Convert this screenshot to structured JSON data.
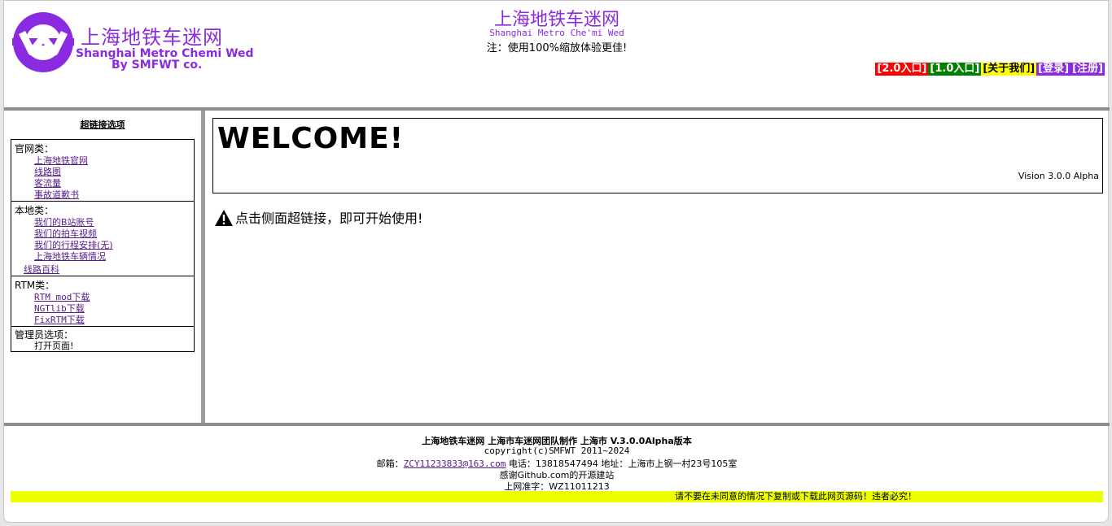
{
  "header": {
    "logo_cn": "上海地铁车迷网",
    "logo_en": "Shanghai Metro Chemi Wed",
    "logo_by": "By SMFWT co.",
    "site_title": "上海地铁车迷网",
    "site_subtitle": "Shanghai Metro Che'mi Wed",
    "site_note": "注：使用100%缩放体验更佳!",
    "nav": [
      {
        "label": "[2.0入口]",
        "bg": "#ff0000"
      },
      {
        "label": "[1.0入口]",
        "bg": "#008000"
      },
      {
        "label": "[关于我们]",
        "bg": "#ffff00"
      },
      {
        "label": "[登录]",
        "bg": "#8a2be2"
      },
      {
        "label": "[注册]",
        "bg": "#8a2be2"
      }
    ]
  },
  "sidebar": {
    "title": "超链接选项",
    "official": {
      "heading": "官网类：",
      "links": [
        "上海地铁官网",
        "线路图",
        "客流量",
        "事故道歉书"
      ]
    },
    "local": {
      "heading": "本地类：",
      "links": [
        "我们的B站账号",
        "我们的拍车视频",
        "我们的行程安排(无)",
        "上海地铁车辆情况"
      ],
      "extra": "线路百科"
    },
    "rtm": {
      "heading": "RTM类：",
      "links": [
        "RTM mod下载",
        "NGTlib下载",
        "FixRTM下载"
      ]
    },
    "admin": {
      "heading": "管理员选项：",
      "item": "打开页面!"
    }
  },
  "main": {
    "welcome": "WELCOME!",
    "version": "Vision 3.0.0 Alpha",
    "instruction": "点击侧面超链接，即可开始使用!"
  },
  "footer": {
    "line1": "上海地铁车迷网   上海市车迷网团队制作   上海市   V.3.0.0Alpha版本",
    "line2": "copyright(c)SMFWT 2011~2024",
    "email_label": "邮箱：",
    "email": "ZCY11233833@163.com",
    "contact": " 电话：13818547494 地址：上海市上钢一村23号105室",
    "line4": "感谢Github.com的开源建站",
    "line5": "上网准字：WZ11011213",
    "warning": "请不要在未同意的情况下复制或下载此网页源码！违者必究！"
  },
  "colors": {
    "brand": "#8a2be2",
    "link_visited": "#551a8b",
    "warning_bg": "#eeff00"
  }
}
